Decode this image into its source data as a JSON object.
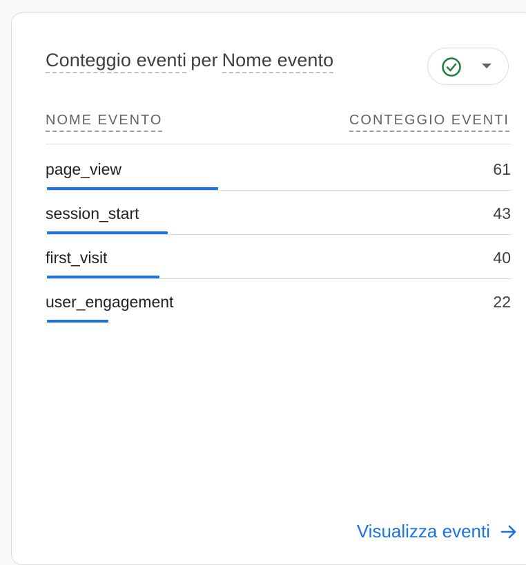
{
  "card": {
    "title_part1": "Conteggio eventi",
    "title_part2": "per",
    "title_part3": "Nome evento",
    "status": "ok"
  },
  "table": {
    "col_name": "NOME EVENTO",
    "col_count": "CONTEGGIO EVENTI",
    "max": 61,
    "rows": [
      {
        "name": "page_view",
        "value": "61",
        "count": 61
      },
      {
        "name": "session_start",
        "value": "43",
        "count": 43
      },
      {
        "name": "first_visit",
        "value": "40",
        "count": 40
      },
      {
        "name": "user_engagement",
        "value": "22",
        "count": 22
      }
    ]
  },
  "footer": {
    "link_label": "Visualizza eventi"
  },
  "colors": {
    "accent": "#1a73e8",
    "check_green": "#188038"
  }
}
